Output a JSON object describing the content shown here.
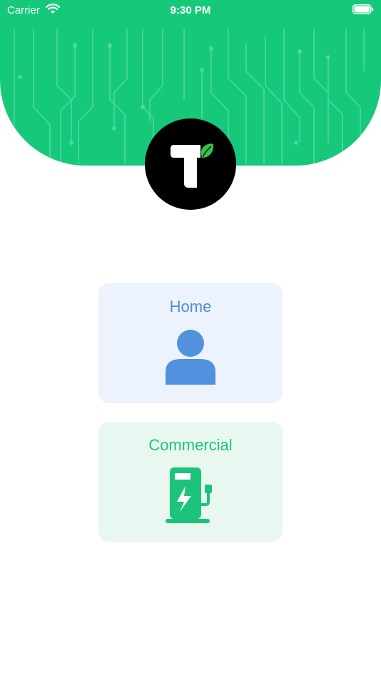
{
  "status_bar": {
    "carrier": "Carrier",
    "time": "9:30 PM",
    "wifi_icon": "wifi-icon",
    "battery_icon": "battery-icon"
  },
  "header": {
    "background_color": "#16c97a",
    "logo_icon": "app-logo-icon"
  },
  "options": {
    "home": {
      "label": "Home",
      "icon": "person-icon",
      "color": "#4f8bd4",
      "background": "#ecf3fc"
    },
    "commercial": {
      "label": "Commercial",
      "icon": "ev-charger-icon",
      "color": "#1cc47b",
      "background": "#e8f8f0"
    }
  }
}
